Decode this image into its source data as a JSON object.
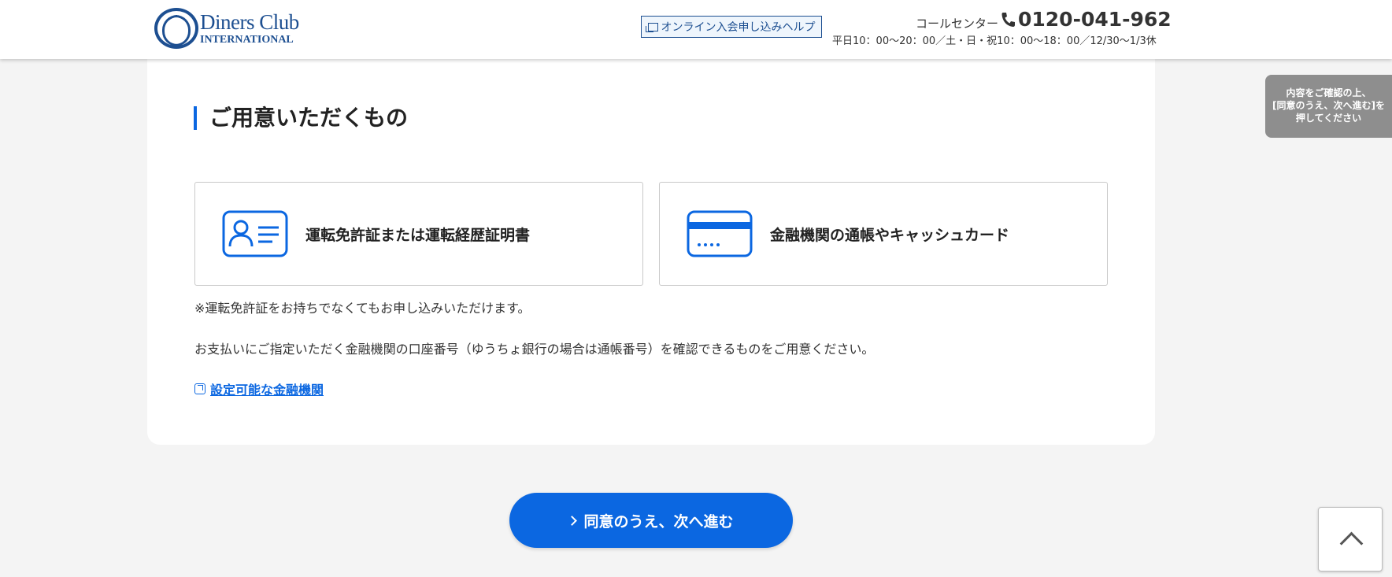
{
  "header": {
    "logo_line1": "Diners Club",
    "logo_line2": "INTERNATIONAL",
    "help_label": "オンライン入会申し込みヘルプ",
    "call_label": "コールセンター",
    "call_number": "0120-041-962",
    "call_hours": "平日10：00〜20：00／土・日・祝10：00〜18：00／12/30〜1/3休"
  },
  "section": {
    "title": "ご用意いただくもの",
    "items": [
      {
        "label": "運転免許証または運転経歴証明書",
        "icon": "id-card-icon"
      },
      {
        "label": "金融機関の通帳やキャッシュカード",
        "icon": "bank-card-icon"
      }
    ],
    "note1": "※運転免許証をお持ちでなくてもお申し込みいただけます。",
    "note2": "お支払いにご指定いただく金融機関の口座番号（ゆうちょ銀行の場合は通帳番号）を確認できるものをご用意ください。",
    "link_label": "設定可能な金融機関"
  },
  "cta": {
    "label": "同意のうえ、次へ進む"
  },
  "side_tip": {
    "line1": "内容をご確認の上、",
    "line2": "[同意のうえ、次へ進む]を",
    "line3": "押してください"
  },
  "colors": {
    "accent": "#0b67e1",
    "brand": "#1d4f91",
    "background": "#f4f4f4",
    "tip_bg": "#8e8e8e"
  }
}
